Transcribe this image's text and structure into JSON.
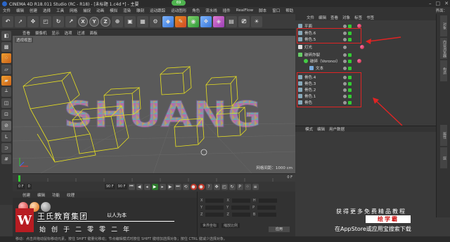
{
  "titlebar": {
    "title": "CINEMA 4D R18.011 Studio (RC - R18) - [未标题 1.c4d *] - 主要",
    "badge": "69"
  },
  "menubar": {
    "items": [
      "文件",
      "编辑",
      "创建",
      "选择",
      "工具",
      "网格",
      "捕捉",
      "动画",
      "模拟",
      "渲染",
      "雕刻",
      "运动跟踪",
      "运动图形",
      "角色",
      "流水线",
      "插件",
      "RealFlow",
      "脚本",
      "窗口",
      "帮助"
    ],
    "right_label": "界面："
  },
  "toolbar": {
    "undo_icon": "undo-icon",
    "x": "X",
    "y": "Y",
    "z": "Z"
  },
  "viewport": {
    "menu": [
      "查看",
      "摄像机",
      "显示",
      "选项",
      "过滤",
      "面板"
    ],
    "label": "透视视图",
    "grid_info": "网格间距：1000 cm",
    "text3d": "SHUANG"
  },
  "timeline": {
    "start": "0",
    "end": "90 F",
    "current": "0 F"
  },
  "transport": {
    "field_left": "0 F",
    "field_right": "90 F"
  },
  "material": {
    "menu": [
      "创建",
      "编辑",
      "功能",
      "纹理"
    ]
  },
  "coords": {
    "rows": [
      {
        "a": "X",
        "a_val": "0 cm",
        "b": "X",
        "b_val": "0 cm",
        "c": "H",
        "c_val": "0 °"
      },
      {
        "a": "Y",
        "a_val": "0 cm",
        "b": "Y",
        "b_val": "0 cm",
        "c": "P",
        "c_val": "0 °"
      },
      {
        "a": "Z",
        "a_val": "0 cm",
        "b": "Z",
        "b_val": "0 cm",
        "c": "B",
        "c_val": "0 °"
      }
    ],
    "mode1": "世界坐标",
    "mode2": "缩放比例",
    "apply": "应用"
  },
  "object_manager": {
    "menu": [
      "文件",
      "编辑",
      "查看",
      "对象",
      "标签",
      "书签"
    ],
    "rows": [
      {
        "name": "平面",
        "indent": 0
      },
      {
        "name": "骨色.6",
        "indent": 0
      },
      {
        "name": "骨色.5",
        "indent": 0
      },
      {
        "name": "灯光",
        "indent": 0
      },
      {
        "name": "破碎炸裂",
        "indent": 0
      },
      {
        "name": "破碎（Voronoi）",
        "indent": 1
      },
      {
        "name": "文本",
        "indent": 2
      },
      {
        "name": "骨色.4",
        "indent": 0
      },
      {
        "name": "骨色.3",
        "indent": 0
      },
      {
        "name": "骨色.2",
        "indent": 0
      },
      {
        "name": "骨色.1",
        "indent": 0
      },
      {
        "name": "骨色",
        "indent": 0
      }
    ]
  },
  "attributes": {
    "menu": [
      "模式",
      "编辑",
      "用户数据"
    ]
  },
  "right_tabs": [
    "对象",
    "内容浏览器",
    "构造",
    "属性",
    "层"
  ],
  "statusbar": {
    "text": "移动：点击并拖动鼠标移动元素。按住 SHIFT 键量化移动；节点编辑模式时按住 SHIFT 键增加选择对象；按住 CTRL 键减少选择对象。"
  },
  "watermark": {
    "logo_letter": "W",
    "name": "王氏教育集团",
    "slogan": "以人为本",
    "since": "始创于二零零二年",
    "right1": "获得更多免费精品教程",
    "right2": "绘学霸",
    "right3": "在AppStore或应用宝搜索下载"
  },
  "colors": {
    "accent_red": "#e02424",
    "brand_red": "#b81c22",
    "cage_yellow": "#e8e020",
    "grid": "#6a6a6a"
  }
}
